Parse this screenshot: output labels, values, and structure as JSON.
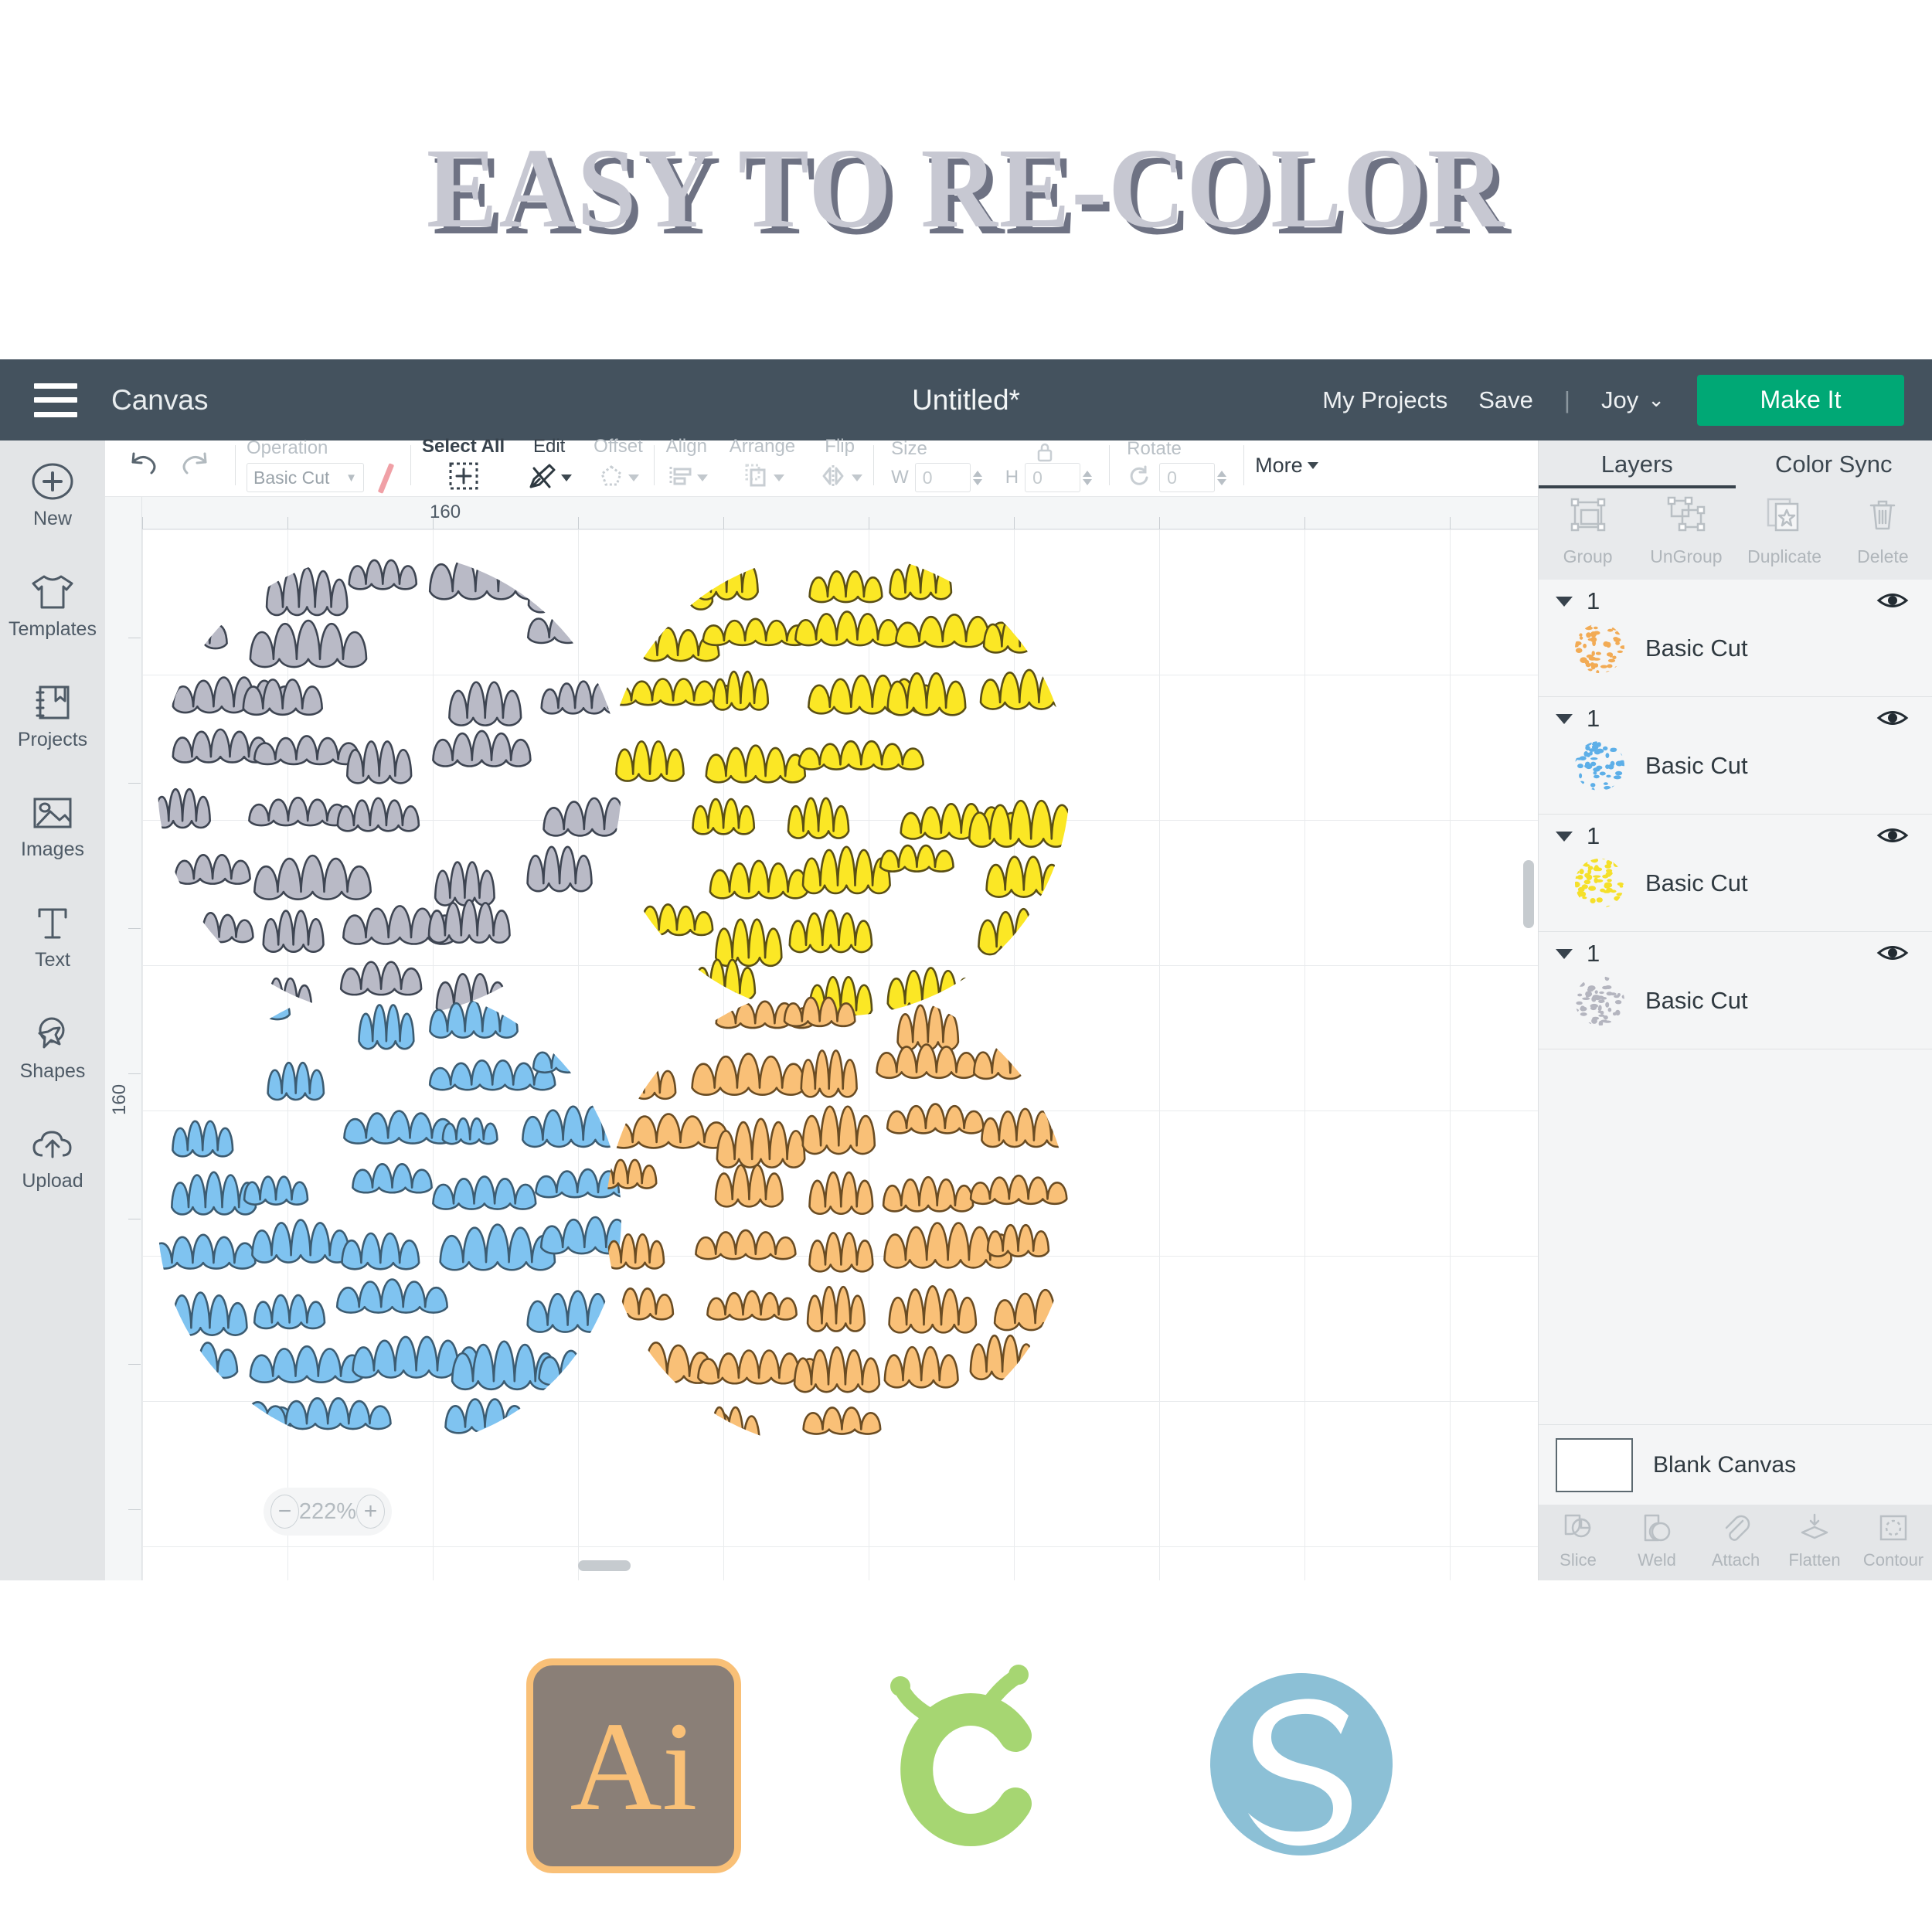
{
  "headline": "EASY TO RE-COLOR",
  "topbar": {
    "menu_icon": "hamburger-icon",
    "canvas_label": "Canvas",
    "document_title": "Untitled*",
    "my_projects": "My Projects",
    "save": "Save",
    "separator": "|",
    "machine": "Joy",
    "make_it": "Make It",
    "accent_color": "#00a875",
    "bg_color": "#44525e"
  },
  "sidebar": {
    "items": [
      {
        "label": "New",
        "icon": "plus-circle-icon"
      },
      {
        "label": "Templates",
        "icon": "tshirt-icon"
      },
      {
        "label": "Projects",
        "icon": "bookmark-book-icon"
      },
      {
        "label": "Images",
        "icon": "photo-icon"
      },
      {
        "label": "Text",
        "icon": "text-t-icon"
      },
      {
        "label": "Shapes",
        "icon": "star-circle-icon"
      },
      {
        "label": "Upload",
        "icon": "cloud-upload-icon"
      }
    ]
  },
  "toolbar": {
    "undo": "undo-icon",
    "redo": "redo-icon",
    "operation_label": "Operation",
    "operation_value": "Basic Cut",
    "color_swatch": "#f0a0a6",
    "select_all": "Select All",
    "edit": "Edit",
    "offset": "Offset",
    "align": "Align",
    "arrange": "Arrange",
    "flip": "Flip",
    "size_label": "Size",
    "width_label": "W",
    "width_value": "0",
    "height_label": "H",
    "height_value": "0",
    "lock_icon": "lock-icon",
    "rotate_label": "Rotate",
    "rotate_value": "0",
    "more": "More"
  },
  "canvas": {
    "ruler_top_label": "160",
    "ruler_left_label": "160",
    "zoom_level": "222%",
    "zoom_out": "−",
    "zoom_in": "+"
  },
  "artwork": {
    "description": "Four circular cloud-pattern medallions",
    "circles": [
      {
        "name": "gray-cloud-circle",
        "fill": "#b9bac6",
        "stroke": "#3e4552"
      },
      {
        "name": "yellow-cloud-circle",
        "fill": "#fbe725",
        "stroke": "#5a4f15"
      },
      {
        "name": "blue-cloud-circle",
        "fill": "#7fc3f0",
        "stroke": "#3c5c72"
      },
      {
        "name": "orange-cloud-circle",
        "fill": "#f9c077",
        "stroke": "#6a4c23"
      }
    ]
  },
  "right_panel": {
    "tabs": [
      {
        "label": "Layers",
        "active": true
      },
      {
        "label": "Color Sync",
        "active": false
      }
    ],
    "actions": [
      {
        "label": "Group",
        "icon": "group-icon"
      },
      {
        "label": "UnGroup",
        "icon": "ungroup-icon"
      },
      {
        "label": "Duplicate",
        "icon": "duplicate-icon"
      },
      {
        "label": "Delete",
        "icon": "trash-icon"
      }
    ],
    "layers": [
      {
        "count": "1",
        "name": "Basic Cut",
        "color": "#f2ab55",
        "visible_icon": "eye-icon"
      },
      {
        "count": "1",
        "name": "Basic Cut",
        "color": "#5dafe8",
        "visible_icon": "eye-icon"
      },
      {
        "count": "1",
        "name": "Basic Cut",
        "color": "#f5e02a",
        "visible_icon": "eye-icon"
      },
      {
        "count": "1",
        "name": "Basic Cut",
        "color": "#b4b5bf",
        "visible_icon": "eye-icon"
      }
    ],
    "blank_canvas": "Blank Canvas",
    "bottom_tools": [
      {
        "label": "Slice",
        "icon": "slice-icon"
      },
      {
        "label": "Weld",
        "icon": "weld-icon"
      },
      {
        "label": "Attach",
        "icon": "paperclip-icon"
      },
      {
        "label": "Flatten",
        "icon": "flatten-icon"
      },
      {
        "label": "Contour",
        "icon": "contour-icon"
      }
    ]
  },
  "footer_logos": [
    {
      "name": "adobe-illustrator-logo",
      "text": "Ai",
      "bg": "#8a7f77",
      "accent": "#f9c077"
    },
    {
      "name": "cricut-design-space-logo",
      "color": "#a6d672"
    },
    {
      "name": "silhouette-studio-logo",
      "color": "#8cc0d6"
    }
  ]
}
